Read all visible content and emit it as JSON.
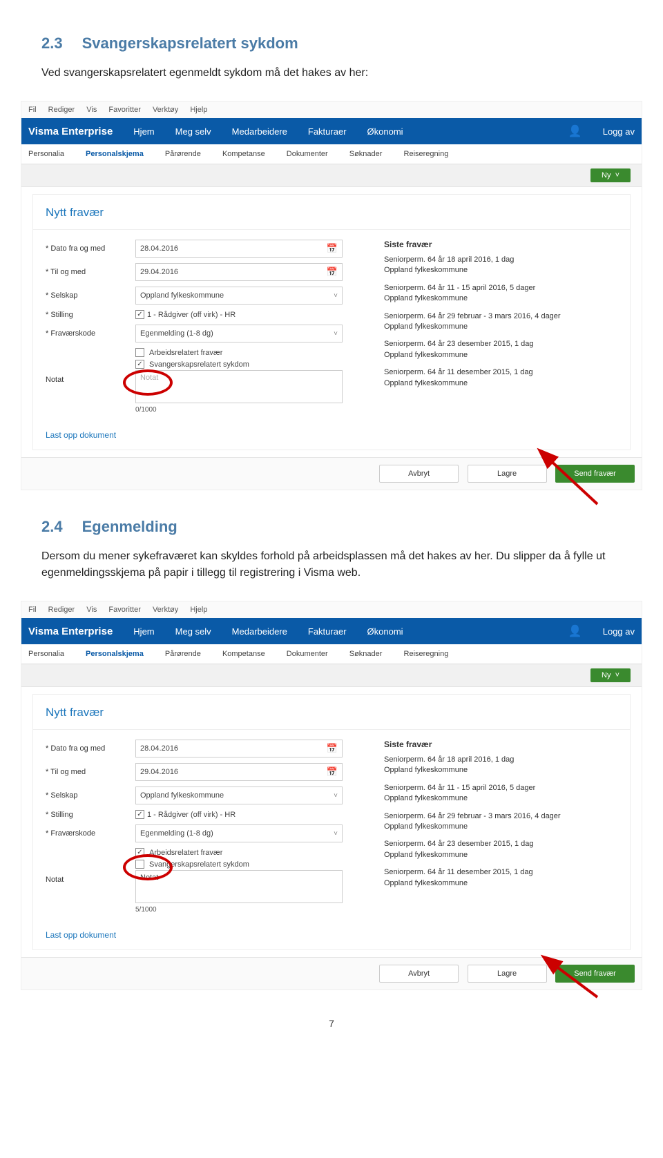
{
  "sections": {
    "s23": {
      "num": "2.3",
      "title": "Svangerskapsrelatert sykdom",
      "text": "Ved svangerskapsrelatert egenmeldt sykdom må det hakes av her:"
    },
    "s24": {
      "num": "2.4",
      "title": "Egenmelding",
      "text": "Dersom du mener sykefraværet kan skyldes forhold på arbeidsplassen må det hakes av her. Du slipper da å fylle ut egenmeldingsskjema på papir i tillegg til registrering i Visma web."
    }
  },
  "app": {
    "menubar": [
      "Fil",
      "Rediger",
      "Vis",
      "Favoritter",
      "Verktøy",
      "Hjelp"
    ],
    "brand": "Visma Enterprise",
    "topnav": [
      "Hjem",
      "Meg selv",
      "Medarbeidere",
      "Fakturaer",
      "Økonomi"
    ],
    "logoff": "Logg av",
    "subnav": [
      "Personalia",
      "Personalskjema",
      "Pårørende",
      "Kompetanse",
      "Dokumenter",
      "Søknader",
      "Reiseregning"
    ],
    "ny_label": "Ny",
    "panel_title": "Nytt fravær",
    "labels": {
      "dato_fra": "* Dato fra og med",
      "til_og_med": "* Til og med",
      "selskap": "* Selskap",
      "stilling": "* Stilling",
      "kode": "* Fraværskode",
      "notat": "Notat"
    },
    "values": {
      "dato_fra": "28.04.2016",
      "til_og_med": "29.04.2016",
      "selskap": "Oppland fylkeskommune",
      "stilling": "1 - Rådgiver (off virk) - HR",
      "kode": "Egenmelding (1-8 dg)",
      "notat_placeholder": "Notat"
    },
    "checks": {
      "arbeid": "Arbeidsrelatert fravær",
      "svanger": "Svangerskapsrelatert sykdom"
    },
    "upload": "Last opp dokument",
    "side_head": "Siste fravær",
    "side_entries": [
      {
        "line1": "Seniorperm. 64 år 18 april 2016, 1 dag",
        "line2": "Oppland fylkeskommune"
      },
      {
        "line1": "Seniorperm. 64 år 11 - 15 april 2016, 5 dager",
        "line2": "Oppland fylkeskommune"
      },
      {
        "line1": "Seniorperm. 64 år 29 februar - 3 mars 2016, 4 dager",
        "line2": "Oppland fylkeskommune"
      },
      {
        "line1": "Seniorperm. 64 år 23 desember 2015, 1 dag",
        "line2": "Oppland fylkeskommune"
      },
      {
        "line1": "Seniorperm. 64 år 11 desember 2015, 1 dag",
        "line2": "Oppland fylkeskommune"
      }
    ],
    "buttons": {
      "cancel": "Avbryt",
      "save": "Lagre",
      "send": "Send fravær"
    }
  },
  "counters": {
    "first": "0/1000",
    "second": "5/1000"
  },
  "pagenum": "7"
}
